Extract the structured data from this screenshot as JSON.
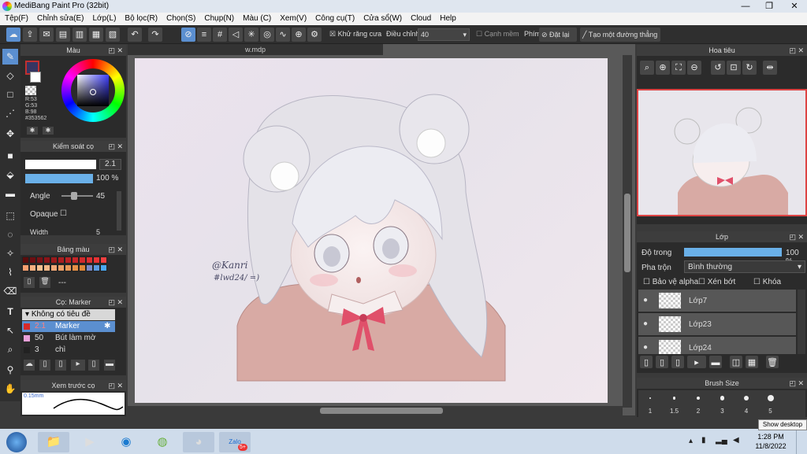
{
  "app": {
    "title": "MediBang Paint Pro (32bit)"
  },
  "menu": [
    "Tệp(F)",
    "Chỉnh sửa(E)",
    "Lớp(L)",
    "Bộ lọc(R)",
    "Chọn(S)",
    "Chụp(N)",
    "Màu (C)",
    "Xem(V)",
    "Công cụ(T)",
    "Cửa sổ(W)",
    "Cloud",
    "Help"
  ],
  "toolbar": {
    "antialias": "Khử răng cưa",
    "correction": "Điều chỉnh",
    "correction_value": "40",
    "edge": "Cạnh mềm",
    "shortcut": "Phím",
    "reset": "Đặt lại",
    "straight": "Tạo một đường thẳng"
  },
  "color": {
    "title": "Màu",
    "r": "R:53",
    "g": "G:53",
    "b": "B:98",
    "hex": "#353562",
    "fg": "#353562"
  },
  "brush_control": {
    "title": "Kiểm soát cọ",
    "size": "2.1",
    "opacity": "100 %",
    "angle_label": "Angle",
    "angle_value": "45",
    "opaque_label": "Opaque",
    "width_label": "Width",
    "width_value": "5"
  },
  "palette": {
    "title": "Bảng màu",
    "dash": "---",
    "colors": [
      "#5a0c0c",
      "#6c0f12",
      "#7a1216",
      "#8a1418",
      "#9a1a1c",
      "#aa1e20",
      "#b82224",
      "#c42628",
      "#d02a2c",
      "#dc2e30",
      "#e83234",
      "#f04040",
      "#f6a070",
      "#f8b080",
      "#f6c090",
      "#f4b888",
      "#f0a878",
      "#eca068",
      "#e89858",
      "#e49048",
      "#e08838",
      "#7a8ac8",
      "#5a9ae0",
      "#4aa8f0"
    ]
  },
  "brush_list": {
    "title": "Cọ: Marker",
    "group": "Không có tiêu đề",
    "items": [
      {
        "size": "2.1",
        "name": "Marker",
        "color": "#d62a2a"
      },
      {
        "size": "50",
        "name": "Bút làm mờ",
        "color": "#e8a0d8"
      },
      {
        "size": "3",
        "name": "chì",
        "color": "#222222"
      }
    ]
  },
  "preview": {
    "title": "Xem trước cọ",
    "size": "0.15mm"
  },
  "document": {
    "tab": "w.mdp",
    "signature1": "@Kanri",
    "signature2": "#lwd24/ =)"
  },
  "navigator": {
    "title": "Hoa tiêu"
  },
  "layers": {
    "title": "Lớp",
    "opacity_label": "Độ trong",
    "opacity_value": "100 %",
    "blend_label": "Pha trộn",
    "blend_value": "Bình thường",
    "protect_alpha": "Bảo vệ alpha",
    "clip": "Xén bớt",
    "lock": "Khóa",
    "items": [
      "Lớp7",
      "Lớp23",
      "Lớp24"
    ]
  },
  "brush_size": {
    "title": "Brush Size",
    "sizes": [
      "1",
      "1.5",
      "2",
      "3",
      "4",
      "5"
    ]
  },
  "taskbar": {
    "time": "1:28 PM",
    "date": "11/8/2022",
    "tooltip": "Show desktop",
    "zalo_badge": "5+"
  }
}
